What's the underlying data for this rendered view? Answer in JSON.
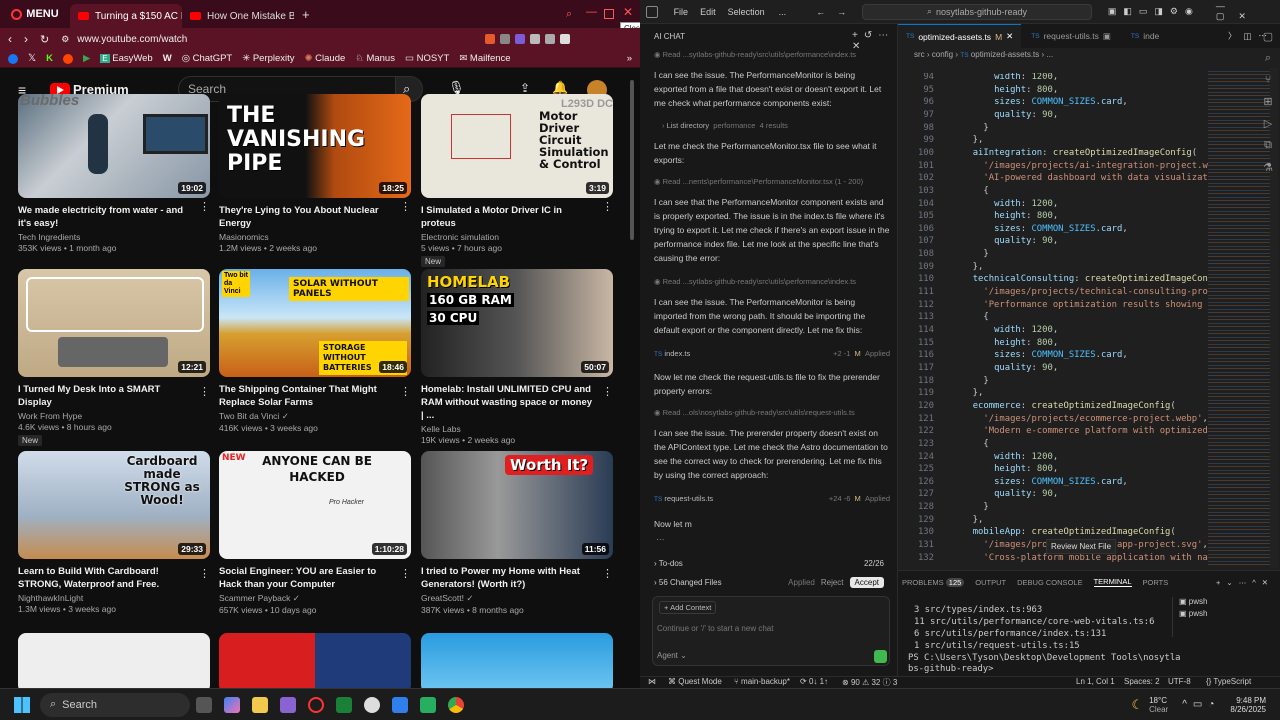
{
  "browser": {
    "menu_label": "MENU",
    "tabs": [
      {
        "title": "Turning a $150 AC Int"
      },
      {
        "title": "How One Mistake Broke C"
      }
    ],
    "url": "www.youtube.com/watch",
    "close_tooltip": "Close",
    "bookmarks": [
      "EasyWeb",
      "ChatGPT",
      "Perplexity",
      "Claude",
      "Manus",
      "NOSYT",
      "Mailfence"
    ]
  },
  "youtube": {
    "premium_label": "Premium",
    "search_placeholder": "Search",
    "videos": [
      {
        "title": "We made electricity from water - and it's easy!",
        "channel": "Tech Ingredients",
        "meta": "353K views • 1 month ago",
        "duration": "19:02",
        "badge": ""
      },
      {
        "title": "They're Lying to You About Nuclear Energy",
        "channel": "Masionomics",
        "meta": "1.2M views • 2 weeks ago",
        "duration": "18:25",
        "badge": ""
      },
      {
        "title": "I Simulated a Motor Driver IC in proteus",
        "channel": "Electronic simulation",
        "meta": "5 views • 7 hours ago",
        "duration": "3:19",
        "badge": "New"
      },
      {
        "title": "I Turned My Desk Into a SMART Display",
        "channel": "Work From Hype",
        "meta": "4.6K views • 8 hours ago",
        "duration": "12:21",
        "badge": "New"
      },
      {
        "title": "The Shipping Container That Might Replace Solar Farms",
        "channel": "Two Bit da Vinci",
        "meta": "416K views • 3 weeks ago",
        "duration": "18:46",
        "badge": ""
      },
      {
        "title": "Homelab: Install UNLIMITED CPU and RAM without wasting space or money | ...",
        "channel": "Kelle Labs",
        "meta": "19K views • 2 weeks ago",
        "duration": "50:07",
        "badge": ""
      },
      {
        "title": "Learn to Build With Cardboard! STRONG, Waterproof and Free.",
        "channel": "NighthawkInLight",
        "meta": "1.3M views • 3 weeks ago",
        "duration": "29:33",
        "badge": ""
      },
      {
        "title": "Social Engineer: YOU are Easier to Hack than your Computer",
        "channel": "Scammer Payback",
        "meta": "657K views • 10 days ago",
        "duration": "1:10:28",
        "badge": ""
      },
      {
        "title": "I tried to Power my Home with Heat Generators! (Worth it?)",
        "channel": "GreatScott!",
        "meta": "387K views • 8 months ago",
        "duration": "11:56",
        "badge": ""
      }
    ],
    "thumb_text": {
      "t1_watermark": "Bubbles",
      "t2": "THE VANISHING PIPE",
      "t3": "Motor Driver Circuit Simulation & Control",
      "t3_chip": "L293D DC",
      "t5_brand": "Two bit da Vinci",
      "t5_top": "SOLAR WITHOUT PANELS",
      "t5_bottom": "STORAGE WITHOUT BATTERIES",
      "t6_title": "HOMELAB",
      "t6_ram": "160 GB RAM",
      "t6_cpu": "30 CPU",
      "t7": "Cardboard made STRONG as Wood!",
      "t8_new": "NEW",
      "t8_title": "ANYONE CAN BE HACKED",
      "t8_sub": "Pro Hacker",
      "t9": "Worth It?"
    }
  },
  "ide": {
    "menus": [
      "File",
      "Edit",
      "Selection",
      "..."
    ],
    "command_center": "nosytlabs-github-ready",
    "chat_title": "AI CHAT",
    "editor_tabs": [
      {
        "label": "optimized-assets.ts",
        "status": "M"
      },
      {
        "label": "request-utils.ts",
        "status": ""
      },
      {
        "label": "inde",
        "status": ""
      }
    ],
    "breadcrumb": [
      "src",
      "config",
      "optimized-assets.ts",
      "..."
    ],
    "chat": {
      "reads": [
        "Read ...sytlabs-github-ready\\src\\utils\\performance\\index.ts",
        "Read ...nents\\performance\\PerformanceMonitor.tsx (1 - 200)",
        "Read ...sytlabs-github-ready\\src\\utils\\performance\\index.ts",
        "Read ...ols\\nosytlabs-github-ready\\src\\utils\\request-utils.ts"
      ],
      "messages": [
        "I can see the issue. The PerformanceMonitor is being exported from a file that doesn't exist or doesn't export it. Let me check what performance components exist:",
        "Let me check the PerformanceMonitor.tsx file to see what it exports:",
        "I can see that the PerformanceMonitor component exists and is properly exported. The issue is in the index.ts file where it's trying to export it. Let me check if there's an export issue in the performance index file. Let me look at the specific line that's causing the error:",
        "I can see the issue. The PerformanceMonitor is being imported from the wrong path. It should be importing the default export or the component directly. Let me fix this:",
        "Now let me check the request-utils.ts file to fix the prerender property errors:",
        "I can see the issue. The prerender property doesn't exist on the APIContext type. Let me check the Astro documentation to see the correct way to check for prerendering. Let me fix this by using the correct approach:",
        "Now let m"
      ],
      "list_dir": {
        "label": "List directory",
        "target": "performance",
        "count": "4 results"
      },
      "files": [
        {
          "name": "index.ts",
          "diff": "+2 -1",
          "status": "M",
          "action": "Applied"
        },
        {
          "name": "request-utils.ts",
          "diff": "+24 -6",
          "status": "M",
          "action": "Applied"
        }
      ],
      "todos_label": "To-dos",
      "todos_count": "22/26",
      "changed_files": "56 Changed Files",
      "applied": "Applied",
      "reject": "Reject",
      "accept": "Accept",
      "add_context": "Add Context",
      "input_placeholder": "Continue or '/' to start a new chat",
      "mode": "Agent"
    },
    "code": [
      {
        "n": "94",
        "html": "      <span class=\"p\">width</span>: <span class=\"n\">1200</span>,"
      },
      {
        "n": "95",
        "html": "      <span class=\"p\">height</span>: <span class=\"n\">800</span>,"
      },
      {
        "n": "96",
        "html": "      <span class=\"p\">sizes</span>: <span class=\"c\">COMMON_SIZES</span>.<span class=\"p\">card</span>,"
      },
      {
        "n": "97",
        "html": "      <span class=\"p\">quality</span>: <span class=\"n\">90</span>,"
      },
      {
        "n": "98",
        "html": "    }"
      },
      {
        "n": "99",
        "html": "  },"
      },
      {
        "n": "100",
        "html": "  <span class=\"p\">aiIntegration</span>: <span class=\"f\">createOptimizedImageConfig</span>("
      },
      {
        "n": "101",
        "html": "    <span class=\"s\">'/images/projects/ai-integration-project.webp'</span>,"
      },
      {
        "n": "102",
        "html": "    <span class=\"s\">'AI-powered dashboard with data visualization'</span>,"
      },
      {
        "n": "103",
        "html": "    {"
      },
      {
        "n": "104",
        "html": "      <span class=\"p\">width</span>: <span class=\"n\">1200</span>,"
      },
      {
        "n": "105",
        "html": "      <span class=\"p\">height</span>: <span class=\"n\">800</span>,"
      },
      {
        "n": "106",
        "html": "      <span class=\"p\">sizes</span>: <span class=\"c\">COMMON_SIZES</span>.<span class=\"p\">card</span>,"
      },
      {
        "n": "107",
        "html": "      <span class=\"p\">quality</span>: <span class=\"n\">90</span>,"
      },
      {
        "n": "108",
        "html": "    }"
      },
      {
        "n": "109",
        "html": "  },"
      },
      {
        "n": "110",
        "html": "  <span class=\"p\">technicalConsulting</span>: <span class=\"f\">createOptimizedImageConfig</span>("
      },
      {
        "n": "111",
        "html": "    <span class=\"s\">'/images/projects/technical-consulting-project.webp'</span>,"
      },
      {
        "n": "112",
        "html": "    <span class=\"s\">'Performance optimization results showing impr'</span>,"
      },
      {
        "n": "113",
        "html": "    {"
      },
      {
        "n": "114",
        "html": "      <span class=\"p\">width</span>: <span class=\"n\">1200</span>,"
      },
      {
        "n": "115",
        "html": "      <span class=\"p\">height</span>: <span class=\"n\">800</span>,"
      },
      {
        "n": "116",
        "html": "      <span class=\"p\">sizes</span>: <span class=\"c\">COMMON_SIZES</span>.<span class=\"p\">card</span>,"
      },
      {
        "n": "117",
        "html": "      <span class=\"p\">quality</span>: <span class=\"n\">90</span>,"
      },
      {
        "n": "118",
        "html": "    }"
      },
      {
        "n": "119",
        "html": "  },"
      },
      {
        "n": "120",
        "html": "  <span class=\"p\">ecommerce</span>: <span class=\"f\">createOptimizedImageConfig</span>("
      },
      {
        "n": "121",
        "html": "    <span class=\"s\">'/images/projects/ecommerce-project.webp'</span>,"
      },
      {
        "n": "122",
        "html": "    <span class=\"s\">'Modern e-commerce platform with optimized us'</span>,"
      },
      {
        "n": "123",
        "html": "    {"
      },
      {
        "n": "124",
        "html": "      <span class=\"p\">width</span>: <span class=\"n\">1200</span>,"
      },
      {
        "n": "125",
        "html": "      <span class=\"p\">height</span>: <span class=\"n\">800</span>,"
      },
      {
        "n": "126",
        "html": "      <span class=\"p\">sizes</span>: <span class=\"c\">COMMON_SIZES</span>.<span class=\"p\">card</span>,"
      },
      {
        "n": "127",
        "html": "      <span class=\"p\">quality</span>: <span class=\"n\">90</span>,"
      },
      {
        "n": "128",
        "html": "    }"
      },
      {
        "n": "129",
        "html": "  },"
      },
      {
        "n": "130",
        "html": "  <span class=\"p\">mobileApp</span>: <span class=\"f\">createOptimizedImageConfig</span>("
      },
      {
        "n": "131",
        "html": "    <span class=\"s\">'/images/projects/mobile-app-project.svg'</span>,"
      },
      {
        "n": "132",
        "html": "    <span class=\"s\">'Cross-platform mobile application with nativ'</span>,"
      }
    ],
    "review_next": "Review Next File",
    "panel_tabs": [
      "PROBLEMS",
      "OUTPUT",
      "DEBUG CONSOLE",
      "TERMINAL",
      "PORTS"
    ],
    "problems_count": "125",
    "terminal_lines": [
      "  3  src/types/index.ts:963",
      " 11  src/utils/performance/core-web-vitals.ts:6",
      "  6  src/utils/performance/index.ts:131",
      "  1  src/utils/request-utils.ts:15",
      "PS C:\\Users\\Tyson\\Desktop\\Development Tools\\nosytla",
      "bs-github-ready>"
    ],
    "shells": [
      "pwsh",
      "pwsh"
    ],
    "status": {
      "quest": "Quest Mode",
      "branch": "main-backup*",
      "sync": "0↓ 1↑",
      "errors": "90",
      "warnings": "32",
      "info": "3",
      "position": "Ln 1, Col 1",
      "spaces": "Spaces: 2",
      "encoding": "UTF-8",
      "language": "TypeScript"
    }
  },
  "taskbar": {
    "search": "Search",
    "weather_temp": "18°C",
    "weather_desc": "Clear",
    "time": "9:48 PM",
    "date": "8/26/2025"
  }
}
